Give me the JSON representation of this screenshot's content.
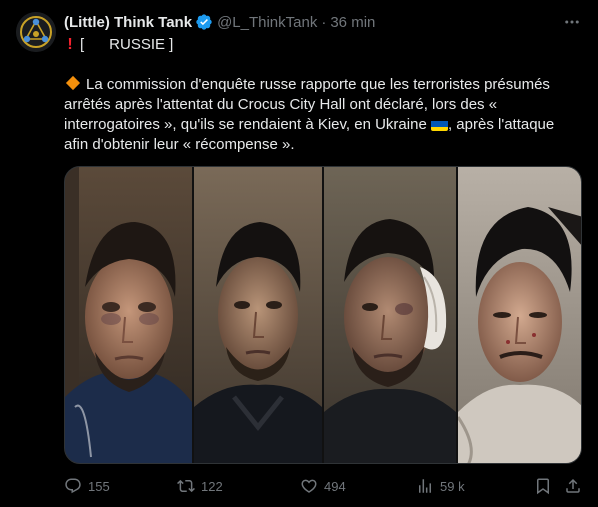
{
  "tweet": {
    "author_name": "(Little) Think Tank",
    "handle": "@L_ThinkTank",
    "separator": "·",
    "time": "36 min",
    "line1_prefix": "[",
    "line1_label": "RUSSIE ]",
    "body": "La commission d'enquête russe rapporte que les terroristes présumés\narrêtés après l'attentat du Crocus City Hall ont déclaré, lors des «\ninterrogatoires », qu'ils se rendaient à Kiev, en Ukraine",
    "body_after_flag": ", après l'attaque\nafin d'obtenir leur « récompense ».",
    "icons": {
      "verified": "verified-badge-icon",
      "more": "more-icon",
      "russia_flag": "russia-flag-icon",
      "ukraine_flag": "ukraine-flag-icon"
    }
  },
  "actions": {
    "replies": "155",
    "reposts": "122",
    "likes": "494",
    "views": "59 k"
  },
  "colors": {
    "background": "#000000",
    "text": "#e7e9ea",
    "muted": "#71767b",
    "verified": "#1d9bf0",
    "alert": "#f4212e",
    "diamond": "#f4900c"
  }
}
